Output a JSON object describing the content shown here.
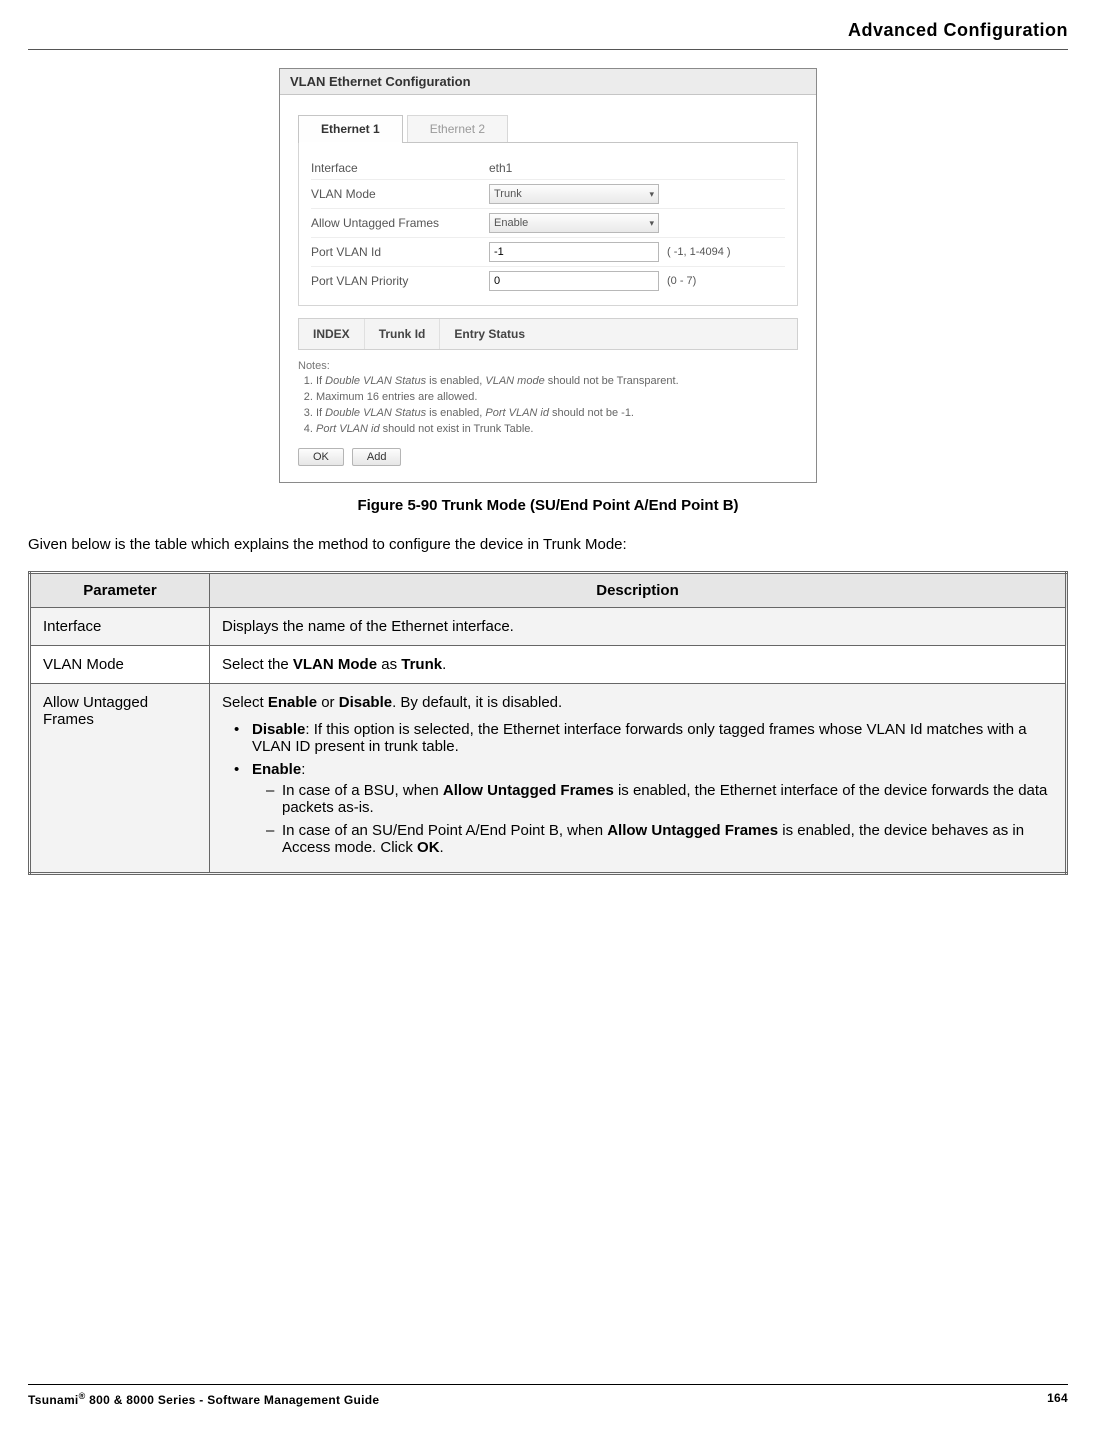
{
  "header": {
    "title": "Advanced Configuration"
  },
  "screenshot": {
    "panel_title": "VLAN Ethernet Configuration",
    "tabs": [
      {
        "label": "Ethernet 1",
        "active": true
      },
      {
        "label": "Ethernet 2",
        "active": false
      }
    ],
    "rows": {
      "interface": {
        "label": "Interface",
        "value": "eth1"
      },
      "vlan_mode": {
        "label": "VLAN Mode",
        "value": "Trunk"
      },
      "allow_untagged": {
        "label": "Allow Untagged Frames",
        "value": "Enable"
      },
      "port_vlan_id": {
        "label": "Port VLAN Id",
        "value": "-1",
        "hint": "( -1, 1-4094 )"
      },
      "port_vlan_priority": {
        "label": "Port VLAN Priority",
        "value": "0",
        "hint": "(0 - 7)"
      }
    },
    "trunk_headers": [
      "INDEX",
      "Trunk Id",
      "Entry Status"
    ],
    "notes_label": "Notes:",
    "notes": [
      {
        "pre": "If ",
        "ital1": "Double VLAN Status",
        "mid": " is enabled, ",
        "ital2": "VLAN mode",
        "post": " should not be Transparent."
      },
      {
        "pre": "Maximum 16 entries are allowed.",
        "ital1": "",
        "mid": "",
        "ital2": "",
        "post": ""
      },
      {
        "pre": "If ",
        "ital1": "Double VLAN Status",
        "mid": " is enabled, ",
        "ital2": "Port VLAN id",
        "post": " should not be -1."
      },
      {
        "pre": "",
        "ital1": "Port VLAN id",
        "mid": " should not exist in Trunk Table.",
        "ital2": "",
        "post": ""
      }
    ],
    "buttons": {
      "ok": "OK",
      "add": "Add"
    }
  },
  "figure_caption": "Figure 5-90 Trunk Mode (SU/End Point A/End Point B)",
  "intro": "Given below is the table which explains the method to configure the device in Trunk Mode:",
  "param_table": {
    "headers": {
      "param": "Parameter",
      "desc": "Description"
    },
    "rows": {
      "interface": {
        "param": "Interface",
        "desc": "Displays the name of the Ethernet interface."
      },
      "vlan_mode": {
        "param": "VLAN Mode",
        "desc_pre": "Select the ",
        "desc_b1": "VLAN Mode",
        "desc_mid": " as ",
        "desc_b2": "Trunk",
        "desc_post": "."
      },
      "allow": {
        "param": "Allow Untagged Frames",
        "top_pre": "Select ",
        "top_b1": "Enable",
        "top_mid1": " or ",
        "top_b2": "Disable",
        "top_post": ". By default, it is disabled.",
        "disable_b": "Disable",
        "disable_txt": ": If this option is selected, the Ethernet interface forwards only tagged frames whose VLAN Id matches with a VLAN ID present in trunk table.",
        "enable_b": "Enable",
        "enable_colon": ":",
        "sub1_pre": "In case of a BSU, when ",
        "sub1_b": "Allow Untagged Frames",
        "sub1_post": " is enabled, the Ethernet interface of the device forwards the data packets as-is.",
        "sub2_pre": "In case of an SU/End Point A/End Point B, when ",
        "sub2_b": "Allow Untagged Frames",
        "sub2_mid": " is enabled, the device behaves as in Access mode. Click ",
        "sub2_b2": "OK",
        "sub2_post": "."
      }
    }
  },
  "footer": {
    "left_pre": "Tsunami",
    "left_reg": "®",
    "left_post": " 800 & 8000 Series - Software Management Guide",
    "page": "164"
  }
}
